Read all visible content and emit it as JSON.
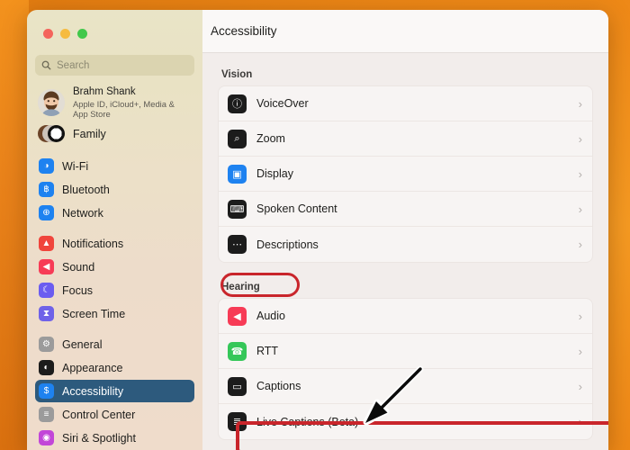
{
  "window": {
    "traffic_lights": [
      "close",
      "minimize",
      "zoom"
    ],
    "colors": {
      "accent_selected": "#2d5a7d",
      "annotation_red": "#c9252b",
      "desktop_orange": "#ef8a18",
      "sidebar_beige": "#e9e4c7",
      "content_bg": "#f2edeb"
    }
  },
  "sidebar": {
    "search": {
      "placeholder": "Search",
      "value": "",
      "icon": "search-icon"
    },
    "profile": {
      "name": "Brahm Shank",
      "subtitle": "Apple ID, iCloud+, Media & App Store",
      "avatar": "user-avatar"
    },
    "family": {
      "label": "Family",
      "icon": "family-avatars-icon"
    },
    "groups": [
      {
        "items": [
          {
            "label": "Wi-Fi",
            "icon": "wifi-icon",
            "color": "#1e82f0",
            "glyph": "◑",
            "selected": false
          },
          {
            "label": "Bluetooth",
            "icon": "bluetooth-icon",
            "color": "#1e82f0",
            "glyph": "฿",
            "selected": false
          },
          {
            "label": "Network",
            "icon": "network-globe-icon",
            "color": "#1e82f0",
            "glyph": "⊕",
            "selected": false
          }
        ]
      },
      {
        "items": [
          {
            "label": "Notifications",
            "icon": "notifications-bell-icon",
            "color": "#f0453c",
            "glyph": "▲",
            "selected": false
          },
          {
            "label": "Sound",
            "icon": "sound-speaker-icon",
            "color": "#f73b56",
            "glyph": "◀",
            "selected": false
          },
          {
            "label": "Focus",
            "icon": "focus-moon-icon",
            "color": "#6b5cf0",
            "glyph": "☾",
            "selected": false
          },
          {
            "label": "Screen Time",
            "icon": "screen-time-hourglass-icon",
            "color": "#6f62e8",
            "glyph": "⧗",
            "selected": false
          }
        ]
      },
      {
        "items": [
          {
            "label": "General",
            "icon": "general-gear-icon",
            "color": "#9b9b9b",
            "glyph": "⚙",
            "selected": false
          },
          {
            "label": "Appearance",
            "icon": "appearance-contrast-icon",
            "color": "#1c1c1c",
            "glyph": "◐",
            "selected": false
          },
          {
            "label": "Accessibility",
            "icon": "accessibility-icon",
            "color": "#1e82f0",
            "glyph": "$",
            "selected": true
          },
          {
            "label": "Control Center",
            "icon": "control-center-toggles-icon",
            "color": "#9b9b9b",
            "glyph": "≡",
            "selected": false
          },
          {
            "label": "Siri & Spotlight",
            "icon": "siri-icon",
            "color": "#c246d8",
            "glyph": "◉",
            "selected": false
          }
        ]
      }
    ]
  },
  "header": {
    "title": "Accessibility"
  },
  "main": {
    "sections": [
      {
        "title": "Vision",
        "highlighted": false,
        "rows": [
          {
            "label": "VoiceOver",
            "icon": "voiceover-icon",
            "color": "#1c1c1c",
            "glyph": "ⓘ",
            "chevron": "›"
          },
          {
            "label": "Zoom",
            "icon": "zoom-magnifier-icon",
            "color": "#1c1c1c",
            "glyph": "⌕",
            "chevron": "›"
          },
          {
            "label": "Display",
            "icon": "display-monitor-icon",
            "color": "#1e82f0",
            "glyph": "▣",
            "chevron": "›"
          },
          {
            "label": "Spoken Content",
            "icon": "spoken-content-icon",
            "color": "#1c1c1c",
            "glyph": "⌨",
            "chevron": "›"
          },
          {
            "label": "Descriptions",
            "icon": "descriptions-icon",
            "color": "#1c1c1c",
            "glyph": "⋯",
            "chevron": "›"
          }
        ]
      },
      {
        "title": "Hearing",
        "highlighted": true,
        "rows": [
          {
            "label": "Audio",
            "icon": "audio-speaker-icon",
            "color": "#f73b56",
            "glyph": "◀",
            "chevron": "›"
          },
          {
            "label": "RTT",
            "icon": "rtt-icon",
            "color": "#35c759",
            "glyph": "☎",
            "chevron": "›"
          },
          {
            "label": "Captions",
            "icon": "captions-icon",
            "color": "#1c1c1c",
            "glyph": "▭",
            "chevron": "›"
          },
          {
            "label": "Live Captions (Beta)",
            "icon": "live-captions-icon",
            "color": "#1c1c1c",
            "glyph": "≣",
            "chevron": "›"
          }
        ]
      }
    ]
  },
  "annotations": {
    "oval_target": "Hearing",
    "box_target": "Live Captions (Beta)",
    "arrow_points_to": "Live Captions (Beta)"
  }
}
